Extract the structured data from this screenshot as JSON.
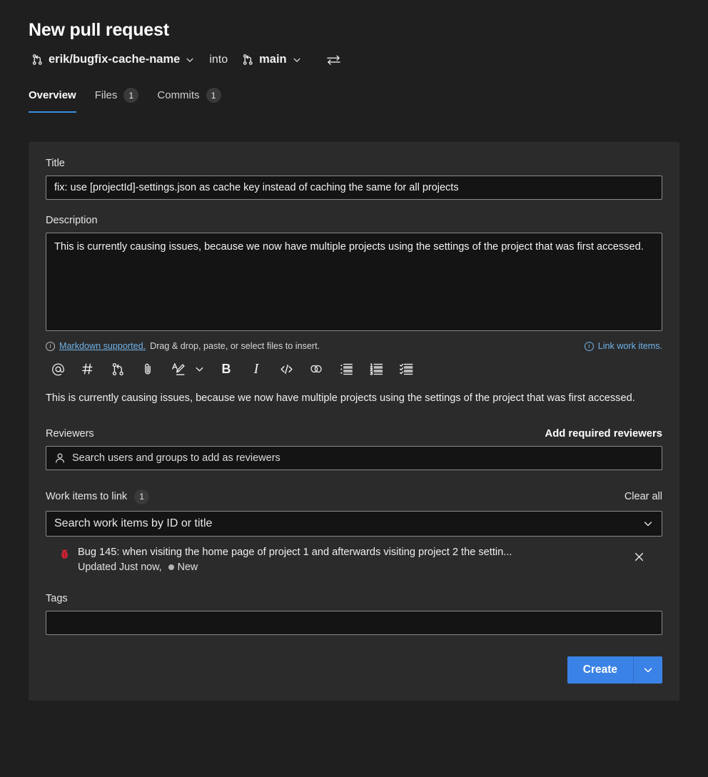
{
  "header": {
    "title": "New pull request",
    "source_branch": "erik/bugfix-cache-name",
    "into_label": "into",
    "target_branch": "main",
    "swap_icon": "swap-arrows-icon",
    "branch_icon": "git-branch-icon",
    "chevron_icon": "chevron-down-icon"
  },
  "tabs": [
    {
      "label": "Overview",
      "count": "",
      "active": true
    },
    {
      "label": "Files",
      "count": "1",
      "active": false
    },
    {
      "label": "Commits",
      "count": "1",
      "active": false
    }
  ],
  "form": {
    "title_label": "Title",
    "title_value": "fix: use [projectId]-settings.json as cache key instead of caching the same for all projects",
    "title_placeholder": "Title",
    "description_label": "Description",
    "description_value": "This is currently causing issues, because we now have multiple projects using the settings of the project that was first accessed.",
    "description_placeholder": "Description",
    "markdown_link": "Markdown supported.",
    "markdown_hint": "Drag & drop, paste, or select files to insert.",
    "link_work_items": "Link work items.",
    "preview_text": "This is currently causing issues, because we now have multiple projects using the settings of the project that was first accessed."
  },
  "toolbar": [
    {
      "name": "mention-icon",
      "glyph": "@"
    },
    {
      "name": "work-item-hash-icon",
      "glyph": "#"
    },
    {
      "name": "pull-request-icon",
      "glyph": ""
    },
    {
      "name": "attachment-paperclip-icon",
      "glyph": ""
    },
    {
      "name": "highlight-pen-icon",
      "glyph": ""
    },
    {
      "name": "chevron-down-icon",
      "glyph": ""
    },
    {
      "name": "bold-icon",
      "glyph": "B"
    },
    {
      "name": "italic-icon",
      "glyph": "I"
    },
    {
      "name": "code-icon",
      "glyph": "</>"
    },
    {
      "name": "link-icon",
      "glyph": ""
    },
    {
      "name": "bulleted-list-icon",
      "glyph": ""
    },
    {
      "name": "numbered-list-icon",
      "glyph": ""
    },
    {
      "name": "task-list-icon",
      "glyph": ""
    }
  ],
  "reviewers": {
    "label": "Reviewers",
    "action": "Add required reviewers",
    "placeholder": "Search users and groups to add as reviewers",
    "icon": "person-icon"
  },
  "work_items": {
    "label": "Work items to link",
    "count": "1",
    "clear_all": "Clear all",
    "placeholder": "Search work items by ID or title",
    "items": [
      {
        "icon": "bug-icon",
        "title": "Bug 145: when visiting the home page of project 1 and afterwards visiting project 2 the settin...",
        "updated": "Updated Just now,",
        "state": "New",
        "remove_icon": "close-icon"
      }
    ]
  },
  "tags": {
    "label": "Tags",
    "value": "",
    "placeholder": ""
  },
  "footer": {
    "create_label": "Create",
    "create_chevron_icon": "chevron-down-icon"
  },
  "colors": {
    "page_bg": "#1f1f1f",
    "card_bg": "#2b2b2b",
    "input_bg": "#141414",
    "accent_blue": "#3b82e6",
    "tab_underline": "#3b8ddd",
    "link_blue": "#6fb2e8",
    "bug_red": "#d6273c"
  }
}
